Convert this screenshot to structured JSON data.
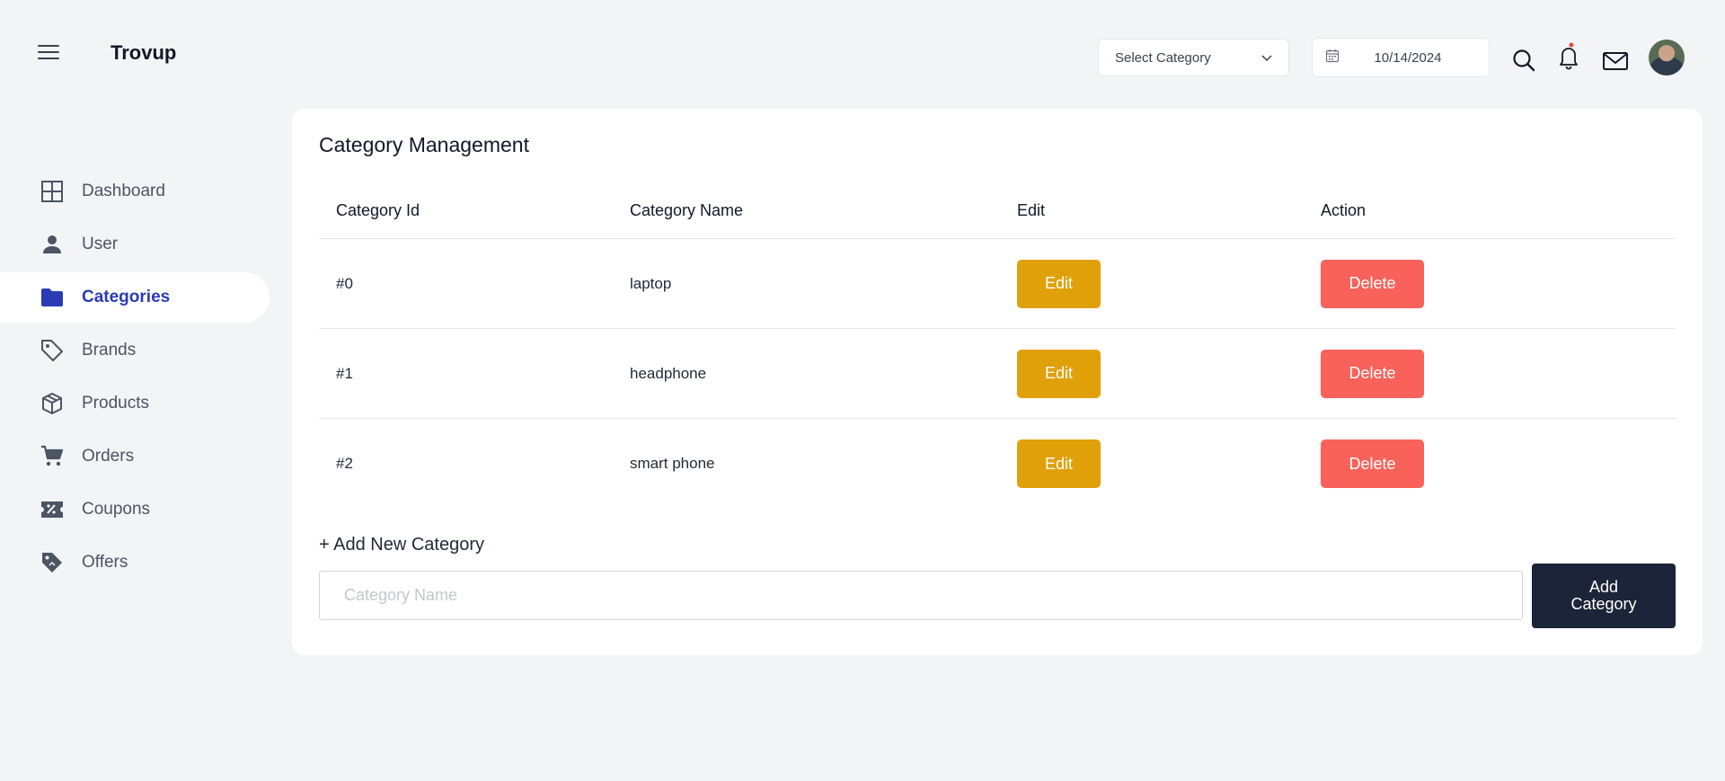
{
  "app": {
    "brand": "Trovup"
  },
  "header": {
    "category_select": "Select Category",
    "date": "10/14/2024"
  },
  "sidebar": {
    "items": [
      {
        "label": "Dashboard",
        "icon": "grid-icon"
      },
      {
        "label": "User",
        "icon": "user-icon"
      },
      {
        "label": "Categories",
        "icon": "folder-icon",
        "active": true
      },
      {
        "label": "Brands",
        "icon": "tag-icon"
      },
      {
        "label": "Products",
        "icon": "box-icon"
      },
      {
        "label": "Orders",
        "icon": "cart-icon"
      },
      {
        "label": "Coupons",
        "icon": "coupon-icon"
      },
      {
        "label": "Offers",
        "icon": "offer-tag-icon"
      }
    ]
  },
  "main": {
    "title": "Category Management",
    "table": {
      "headers": [
        "Category Id",
        "Category Name",
        "Edit",
        "Action"
      ],
      "rows": [
        {
          "id": "#0",
          "name": "laptop",
          "edit": "Edit",
          "action": "Delete"
        },
        {
          "id": "#1",
          "name": "headphone",
          "edit": "Edit",
          "action": "Delete"
        },
        {
          "id": "#2",
          "name": "smart phone",
          "edit": "Edit",
          "action": "Delete"
        }
      ]
    },
    "add_section": {
      "label": "+ Add New Category",
      "placeholder": "Category Name",
      "button": "Add Category"
    }
  },
  "colors": {
    "accent": "#2b3bb5",
    "edit": "#e0a00a",
    "delete": "#f8625a",
    "primary_button": "#1b2438",
    "notification_dot": "#ef4444"
  }
}
